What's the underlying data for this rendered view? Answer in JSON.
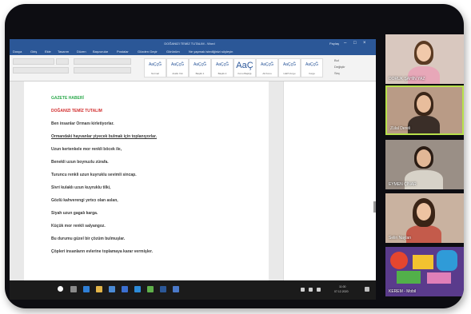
{
  "word": {
    "title": "DOĞANIZI TEMİZ TUTALIM - Word",
    "share_label": "Paylaş",
    "menu": [
      "Dosya",
      "Giriş",
      "Ekle",
      "Tasarım",
      "Düzen",
      "Başvurular",
      "Postalar",
      "Gözden Geçir",
      "Görünüm",
      "Ne yapmak istediğinizi söyleyin"
    ],
    "styles": [
      {
        "sample": "AaÇçĞ",
        "name": "Normal"
      },
      {
        "sample": "AaÇçĞ",
        "name": "Aralık Yok"
      },
      {
        "sample": "AaÇçĞ",
        "name": "Başlık 1"
      },
      {
        "sample": "AaÇçĞ",
        "name": "Başlık 2"
      },
      {
        "sample": "AaÇ",
        "name": "Konu Başlığı"
      },
      {
        "sample": "AaÇçĞ",
        "name": "Alt Konu"
      },
      {
        "sample": "AaÇçĞ",
        "name": "Hafif Vurgu"
      },
      {
        "sample": "AaÇçĞ",
        "name": "Vurgu"
      }
    ],
    "editing": [
      "Bul",
      "Değiştir",
      "Seç"
    ],
    "document": {
      "heading_green": "GAZETE HABERİ",
      "heading_red": "DOĞANIZI TEMİZ TUTALIM",
      "lines": [
        "Ben insanlar Ormanı kirletiyorlar.",
        "Ormandaki hayvanlar yiyecek bulmak için toplanıyorlar.",
        "Uzun kertenkele mor renkli böcek ile,",
        "Benekli uzun boynuzlu zürafa.",
        "Turuncu renkli uzun kuyruklu sevimli sincap.",
        "Sivri kulaklı uzun kuyruklu tilki,",
        "Gözlü kahverengi yırtıcı olan aslan,",
        "Siyah uzun gagalı karga.",
        "Küçük mor renkli salyangoz.",
        "Bu durumu güzel bir çözüm bulmuşlar.",
        "Çöpleri insanların evlerine toplamaya karar vermişler."
      ]
    },
    "taskbar": {
      "time": "11:00",
      "date": "07.12.2020"
    }
  },
  "participants": [
    {
      "name": "DORUK ŞAHİN YAZ",
      "bg": "#d9c8bf"
    },
    {
      "name": "Zülal Dereli",
      "bg": "#b99b86"
    },
    {
      "name": "EYMEN ÇİNAR",
      "bg": "#9a8f86"
    },
    {
      "name": "Selin Naylan",
      "bg": "#c9b2a0"
    },
    {
      "name": "KEREM - Mobil",
      "bg": "#5a3b8c"
    }
  ],
  "colors": {
    "word_blue": "#2b5797",
    "heading_green": "#2eaa4e",
    "heading_red": "#d22f2f"
  }
}
